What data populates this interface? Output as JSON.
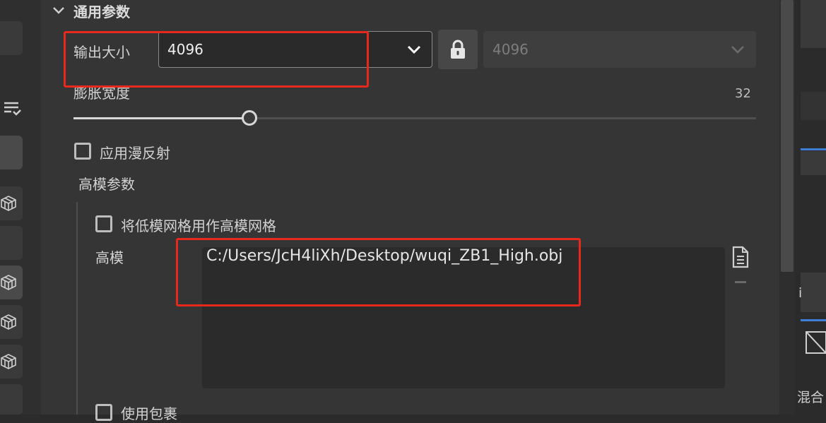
{
  "section": {
    "title": "通用参数"
  },
  "output_size": {
    "label": "输出大小",
    "value": "4096",
    "linked_value": "4096"
  },
  "dilation": {
    "label": "膨胀宽度",
    "value": "32",
    "fraction": 0.258
  },
  "diffuse": {
    "label": "应用漫反射",
    "checked": false
  },
  "high_poly": {
    "section_label": "高模参数",
    "use_low_as_high_label": "将低模网格用作高模网格",
    "use_low_as_high_checked": false,
    "mesh_label": "高模",
    "mesh_path": "C:/Users/JcH4liXh/Desktop/wuqi_ZB1_High.obj"
  },
  "use_cage": {
    "label": "使用包裹",
    "checked": false
  },
  "right_panel": {
    "partial_text_1": "i",
    "partial_text_2": "混合"
  },
  "colors": {
    "highlight": "#e8271d",
    "accent": "#3d7fd6"
  },
  "icons": [
    "chevron-down-icon",
    "lock-icon",
    "file-icon",
    "minus-icon",
    "cube-icon",
    "list-filter-icon"
  ]
}
